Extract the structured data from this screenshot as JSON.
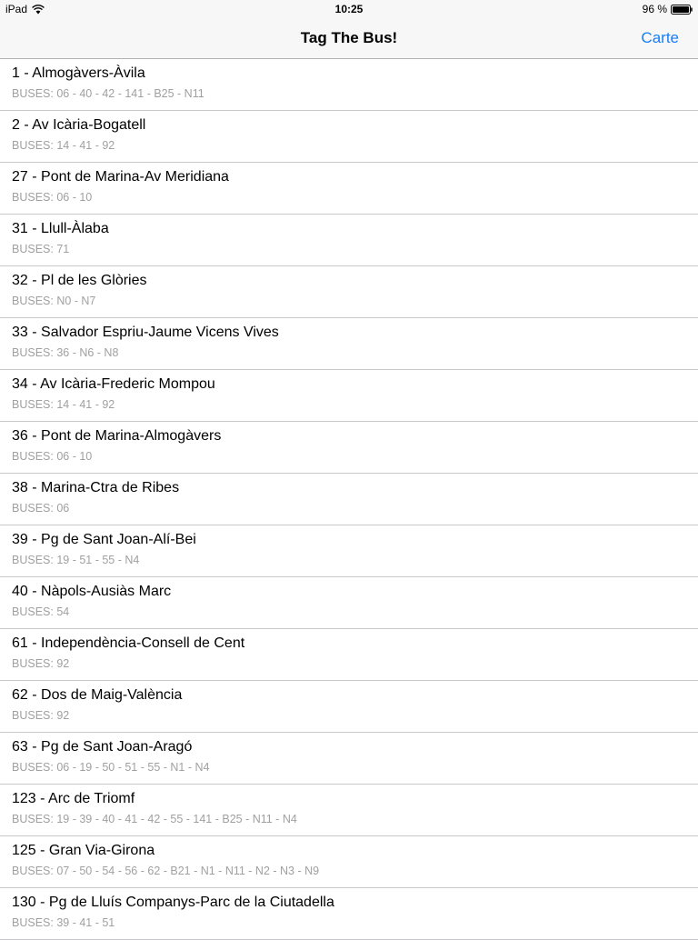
{
  "status_bar": {
    "device": "iPad",
    "time": "10:25",
    "battery": "96 %"
  },
  "nav": {
    "title": "Tag The Bus!",
    "right_button": "Carte"
  },
  "stops": [
    {
      "title": "1 - Almogàvers-Àvila",
      "buses": "BUSES: 06 - 40 - 42 - 141 - B25 - N11"
    },
    {
      "title": "2 - Av Icària-Bogatell",
      "buses": "BUSES: 14 - 41 - 92"
    },
    {
      "title": "27 - Pont de Marina-Av Meridiana",
      "buses": "BUSES: 06 - 10"
    },
    {
      "title": "31 - Llull-Àlaba",
      "buses": "BUSES: 71"
    },
    {
      "title": "32 - Pl de les Glòries",
      "buses": "BUSES: N0 - N7"
    },
    {
      "title": "33 - Salvador Espriu-Jaume Vicens Vives",
      "buses": "BUSES: 36 - N6 - N8"
    },
    {
      "title": "34 - Av Icària-Frederic Mompou",
      "buses": "BUSES: 14 - 41 - 92"
    },
    {
      "title": "36 - Pont de Marina-Almogàvers",
      "buses": "BUSES: 06 - 10"
    },
    {
      "title": "38 - Marina-Ctra de Ribes",
      "buses": "BUSES: 06"
    },
    {
      "title": "39 - Pg de Sant Joan-Alí-Bei",
      "buses": "BUSES: 19 - 51 - 55 - N4"
    },
    {
      "title": "40 - Nàpols-Ausiàs Marc",
      "buses": "BUSES: 54"
    },
    {
      "title": "61 - Independència-Consell de Cent",
      "buses": "BUSES: 92"
    },
    {
      "title": "62 - Dos de Maig-València",
      "buses": "BUSES: 92"
    },
    {
      "title": "63 - Pg de Sant Joan-Aragó",
      "buses": "BUSES: 06 - 19 - 50 - 51 - 55 - N1 - N4"
    },
    {
      "title": "123 - Arc de Triomf",
      "buses": "BUSES: 19 - 39 - 40 - 41 - 42 - 55 - 141 - B25 - N11 - N4"
    },
    {
      "title": "125 - Gran Via-Girona",
      "buses": "BUSES: 07 - 50 - 54 - 56 - 62 - B21 - N1 - N11 - N2 - N3 - N9"
    },
    {
      "title": "130 - Pg de Lluís Companys-Parc de la Ciutadella",
      "buses": "BUSES: 39 - 41 - 51"
    }
  ],
  "colors": {
    "accent": "#157efb",
    "subtitle": "#a0a0a0",
    "separator": "#c8c7cc"
  },
  "icons": [
    "wifi-icon",
    "battery-icon"
  ]
}
